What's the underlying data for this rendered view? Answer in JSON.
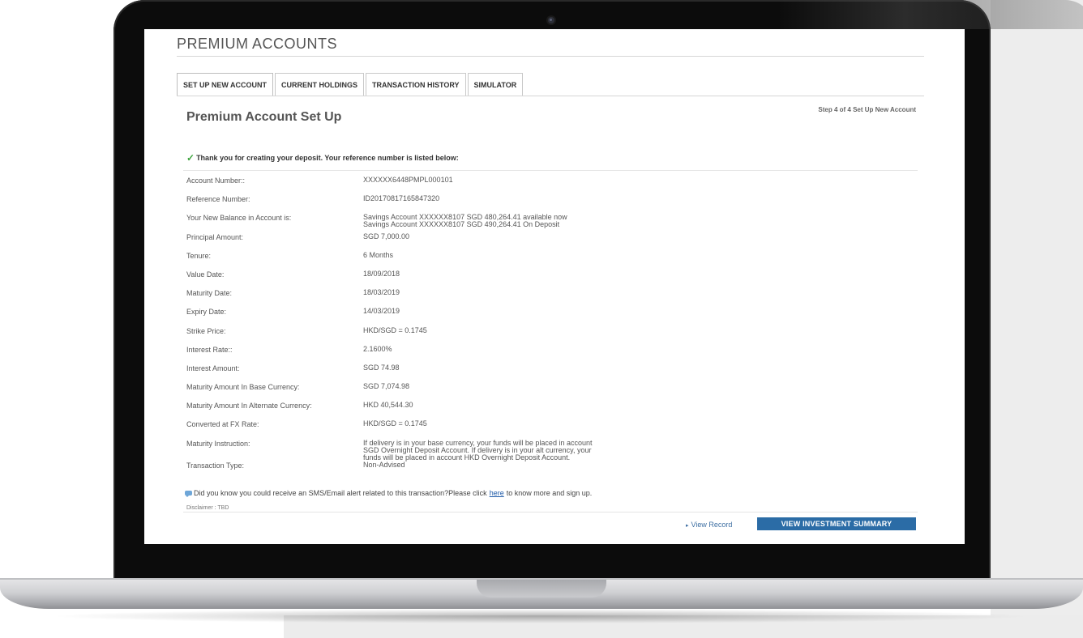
{
  "app": {
    "title": "PREMIUM ACCOUNTS"
  },
  "tabs": [
    {
      "label": "SET UP NEW ACCOUNT"
    },
    {
      "label": "CURRENT HOLDINGS"
    },
    {
      "label": "TRANSACTION HISTORY"
    },
    {
      "label": "SIMULATOR"
    }
  ],
  "page": {
    "title": "Premium Account Set Up",
    "step": "Step 4 of 4 Set Up New Account",
    "thanks": "Thank you for creating your deposit. Your reference number is listed below:"
  },
  "details": [
    {
      "label": "Account Number::",
      "value": [
        "XXXXXX6448PMPL000101"
      ]
    },
    {
      "label": "Reference Number:",
      "value": [
        "ID20170817165847320"
      ]
    },
    {
      "label": "Your New Balance in Account is:",
      "value": [
        "Savings Account XXXXXX8107 SGD 480,264.41 available now",
        "Savings Account XXXXXX8107 SGD 490,264.41 On Deposit"
      ]
    },
    {
      "label": "Principal Amount:",
      "value": [
        "SGD 7,000.00"
      ]
    },
    {
      "label": "Tenure:",
      "value": [
        "6 Months"
      ]
    },
    {
      "label": "Value Date:",
      "value": [
        "18/09/2018"
      ]
    },
    {
      "label": "Maturity Date:",
      "value": [
        "18/03/2019"
      ]
    },
    {
      "label": "Expiry Date:",
      "value": [
        "14/03/2019"
      ]
    },
    {
      "label": "Strike Price:",
      "value": [
        "HKD/SGD = 0.1745"
      ]
    },
    {
      "label": "Interest Rate::",
      "value": [
        "2.1600%"
      ]
    },
    {
      "label": "Interest Amount:",
      "value": [
        "SGD 74.98"
      ]
    },
    {
      "label": "Maturity Amount In Base Currency:",
      "value": [
        "SGD 7,074.98"
      ]
    },
    {
      "label": "Maturity Amount In Alternate Currency:",
      "value": [
        "HKD 40,544.30"
      ]
    },
    {
      "label": "Converted at FX Rate:",
      "value": [
        "HKD/SGD = 0.1745"
      ]
    },
    {
      "label": "Maturity Instruction:",
      "value": [
        "If delivery is in your base currency, your funds will be placed in account",
        "SGD Overnight Deposit Account. If delivery is in your alt currency, your",
        "funds will be placed in account HKD Overnight Deposit Account."
      ]
    },
    {
      "label": "Transaction Type:",
      "value": [
        "Non-Advised"
      ]
    }
  ],
  "notice": {
    "before": "Did you know you could receive an SMS/Email alert related to this transaction?Please click",
    "link": "here",
    "after": "to know more and sign up."
  },
  "disclaimer": "Disclaimer : TBD",
  "actions": {
    "view_record": "View Record",
    "summary_button": "VIEW INVESTMENT SUMMARY"
  },
  "icons": {
    "check": "check-icon",
    "chat": "chat-icon",
    "arrow": "arrow-right-icon"
  },
  "colors": {
    "accent_button": "#2b6ca6",
    "link": "#1e5aa8",
    "check": "#3fa53f"
  }
}
